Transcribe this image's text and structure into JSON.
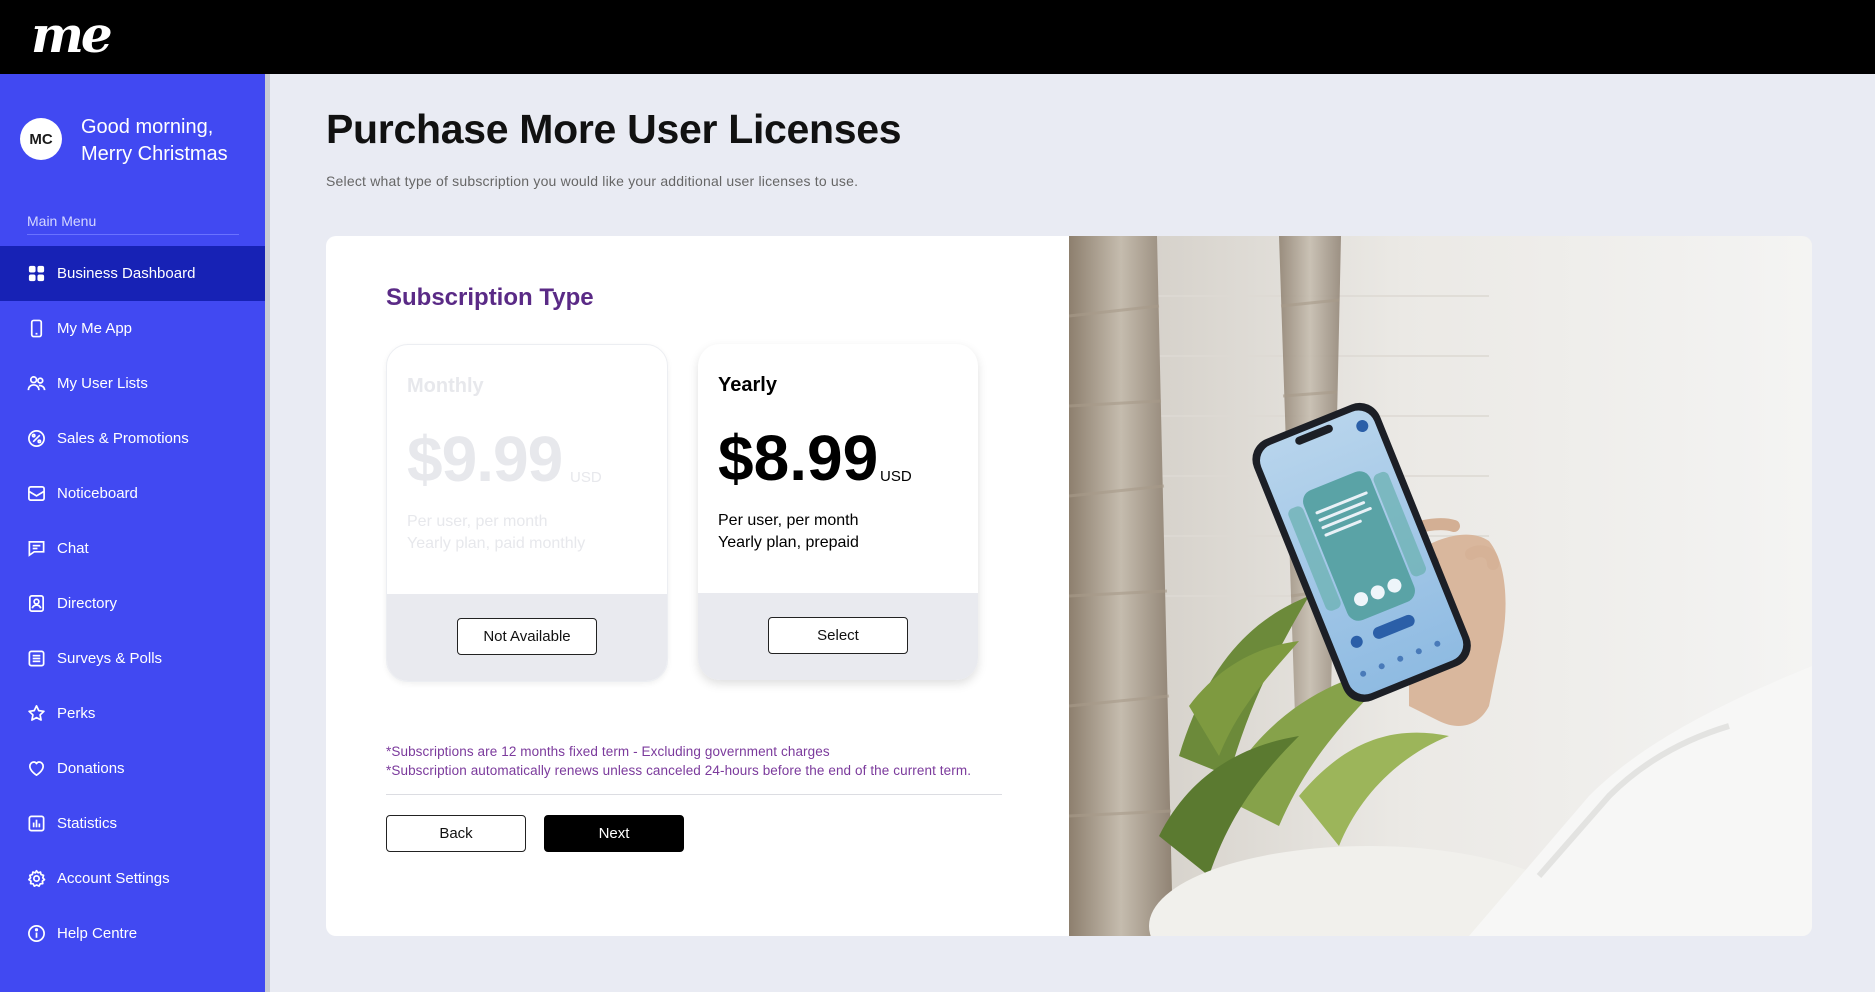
{
  "app": {
    "logo_text": "me"
  },
  "profile": {
    "initials": "MC",
    "greeting_line1": "Good morning,",
    "greeting_line2": "Merry Christmas"
  },
  "sidebar": {
    "menu_title": "Main Menu",
    "items": [
      {
        "label": "Business Dashboard",
        "icon": "dashboard-grid-icon",
        "active": true
      },
      {
        "label": "My Me App",
        "icon": "phone-icon"
      },
      {
        "label": "My User Lists",
        "icon": "users-icon"
      },
      {
        "label": "Sales & Promotions",
        "icon": "percent-badge-icon"
      },
      {
        "label": "Noticeboard",
        "icon": "envelope-board-icon"
      },
      {
        "label": "Chat",
        "icon": "chat-icon"
      },
      {
        "label": "Directory",
        "icon": "contact-card-icon"
      },
      {
        "label": "Surveys & Polls",
        "icon": "list-icon"
      },
      {
        "label": "Perks",
        "icon": "star-icon"
      },
      {
        "label": "Donations",
        "icon": "heart-icon"
      },
      {
        "label": "Statistics",
        "icon": "bar-chart-icon"
      },
      {
        "label": "Account Settings",
        "icon": "gear-icon"
      },
      {
        "label": "Help Centre",
        "icon": "info-icon"
      }
    ]
  },
  "main": {
    "title": "Purchase More User Licenses",
    "subtitle": "Select what type of subscription you would like your additional user licenses to use.",
    "section_title": "Subscription Type",
    "plans": [
      {
        "name": "Monthly",
        "price": "$9.99",
        "currency": "USD",
        "desc_line1": "Per user, per month",
        "desc_line2": "Yearly plan, paid monthly",
        "button_label": "Not Available",
        "available": false
      },
      {
        "name": "Yearly",
        "price": "$8.99",
        "currency": "USD",
        "desc_line1": "Per user, per month",
        "desc_line2": "Yearly plan, prepaid",
        "button_label": "Select",
        "available": true
      }
    ],
    "note_line1": "*Subscriptions are 12 months fixed term - Excluding government charges",
    "note_line2": "*Subscription automatically renews unless canceled 24-hours before the end of the current term.",
    "back_label": "Back",
    "next_label": "Next"
  },
  "colors": {
    "sidebar": "#4149f2",
    "sidebar_active": "#1722b5",
    "section_title": "#5a2a86",
    "notes": "#7b3a9c"
  }
}
